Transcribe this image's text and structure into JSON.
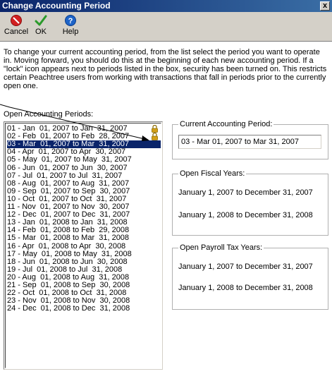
{
  "window": {
    "title": "Change Accounting Period",
    "close_label": "x"
  },
  "toolbar": {
    "cancel_label": "Cancel",
    "ok_label": "OK",
    "help_label": "Help"
  },
  "intro_text": "To change your current accounting period, from the list select the period you want to operate in. Moving forward, you should do this at the beginning of each new accounting period.  If a \"lock\" icon appears next to periods listed in the box, security has been turned on.  This restricts certain Peachtree users from working with transactions that fall in periods prior to the currently open one.",
  "open_periods": {
    "label": "Open Accounting Periods:",
    "items": [
      {
        "text": "01 - Jan  01, 2007 to Jan  31, 2007",
        "locked": true
      },
      {
        "text": "02 - Feb  01, 2007 to Feb  28, 2007",
        "locked": true
      },
      {
        "text": "03 - Mar  01, 2007 to Mar  31, 2007",
        "locked": false,
        "selected": true
      },
      {
        "text": "04 - Apr  01, 2007 to Apr  30, 2007",
        "locked": false
      },
      {
        "text": "05 - May  01, 2007 to May  31, 2007",
        "locked": false
      },
      {
        "text": "06 - Jun  01, 2007 to Jun  30, 2007",
        "locked": false
      },
      {
        "text": "07 - Jul  01, 2007 to Jul  31, 2007",
        "locked": false
      },
      {
        "text": "08 - Aug  01, 2007 to Aug  31, 2007",
        "locked": false
      },
      {
        "text": "09 - Sep  01, 2007 to Sep  30, 2007",
        "locked": false
      },
      {
        "text": "10 - Oct  01, 2007 to Oct  31, 2007",
        "locked": false
      },
      {
        "text": "11 - Nov  01, 2007 to Nov  30, 2007",
        "locked": false
      },
      {
        "text": "12 - Dec  01, 2007 to Dec  31, 2007",
        "locked": false
      },
      {
        "text": "13 - Jan  01, 2008 to Jan  31, 2008",
        "locked": false
      },
      {
        "text": "14 - Feb  01, 2008 to Feb  29, 2008",
        "locked": false
      },
      {
        "text": "15 - Mar  01, 2008 to Mar  31, 2008",
        "locked": false
      },
      {
        "text": "16 - Apr  01, 2008 to Apr  30, 2008",
        "locked": false
      },
      {
        "text": "17 - May  01, 2008 to May  31, 2008",
        "locked": false
      },
      {
        "text": "18 - Jun  01, 2008 to Jun  30, 2008",
        "locked": false
      },
      {
        "text": "19 - Jul  01, 2008 to Jul  31, 2008",
        "locked": false
      },
      {
        "text": "20 - Aug  01, 2008 to Aug  31, 2008",
        "locked": false
      },
      {
        "text": "21 - Sep  01, 2008 to Sep  30, 2008",
        "locked": false
      },
      {
        "text": "22 - Oct  01, 2008 to Oct  31, 2008",
        "locked": false
      },
      {
        "text": "23 - Nov  01, 2008 to Nov  30, 2008",
        "locked": false
      },
      {
        "text": "24 - Dec  01, 2008 to Dec  31, 2008",
        "locked": false
      }
    ]
  },
  "current_period": {
    "label": "Current Accounting Period:",
    "value": "03 - Mar 01, 2007 to Mar 31, 2007"
  },
  "fiscal_years": {
    "label": "Open Fiscal Years:",
    "items": [
      "January 1, 2007 to December 31, 2007",
      "January 1, 2008 to December 31, 2008"
    ]
  },
  "payroll_years": {
    "label": "Open Payroll Tax Years:",
    "items": [
      "January 1, 2007 to December 31, 2007",
      "January 1, 2008 to December 31, 2008"
    ]
  },
  "colors": {
    "selection": "#0a246a",
    "titlebar": "#0a246a",
    "cancel_icon": "#d22020",
    "ok_icon": "#2a9a2a",
    "help_icon": "#1e64c8",
    "lock": "#d4a017"
  }
}
